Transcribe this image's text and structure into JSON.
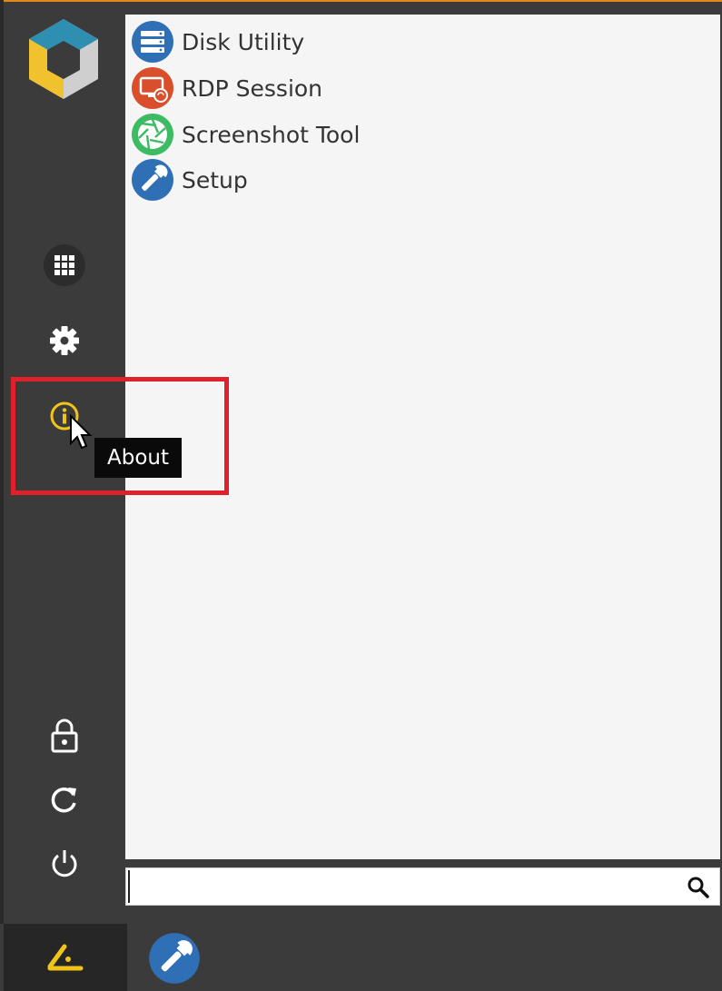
{
  "apps": [
    {
      "label": "Disk Utility",
      "icon": "disk-icon",
      "color": "#2f6fb5"
    },
    {
      "label": "RDP Session",
      "icon": "rdp-icon",
      "color": "#d94f2b"
    },
    {
      "label": "Screenshot Tool",
      "icon": "screenshot-icon",
      "color": "#3dbb63"
    },
    {
      "label": "Setup",
      "icon": "wrench-icon",
      "color": "#2f6fb5"
    }
  ],
  "sidebar": {
    "items": [
      {
        "name": "apps-grid",
        "icon": "grid-icon"
      },
      {
        "name": "settings",
        "icon": "gear-icon"
      },
      {
        "name": "about",
        "icon": "info-icon",
        "accent": "#f0c419"
      },
      {
        "name": "lock",
        "icon": "lock-icon"
      },
      {
        "name": "restart",
        "icon": "refresh-icon"
      },
      {
        "name": "power",
        "icon": "power-icon"
      }
    ]
  },
  "tooltip": {
    "text": "About"
  },
  "search": {
    "value": "",
    "placeholder": ""
  },
  "colors": {
    "accent": "#e08a1e",
    "highlight": "#e0202a",
    "start_icon": "#f0c419"
  }
}
